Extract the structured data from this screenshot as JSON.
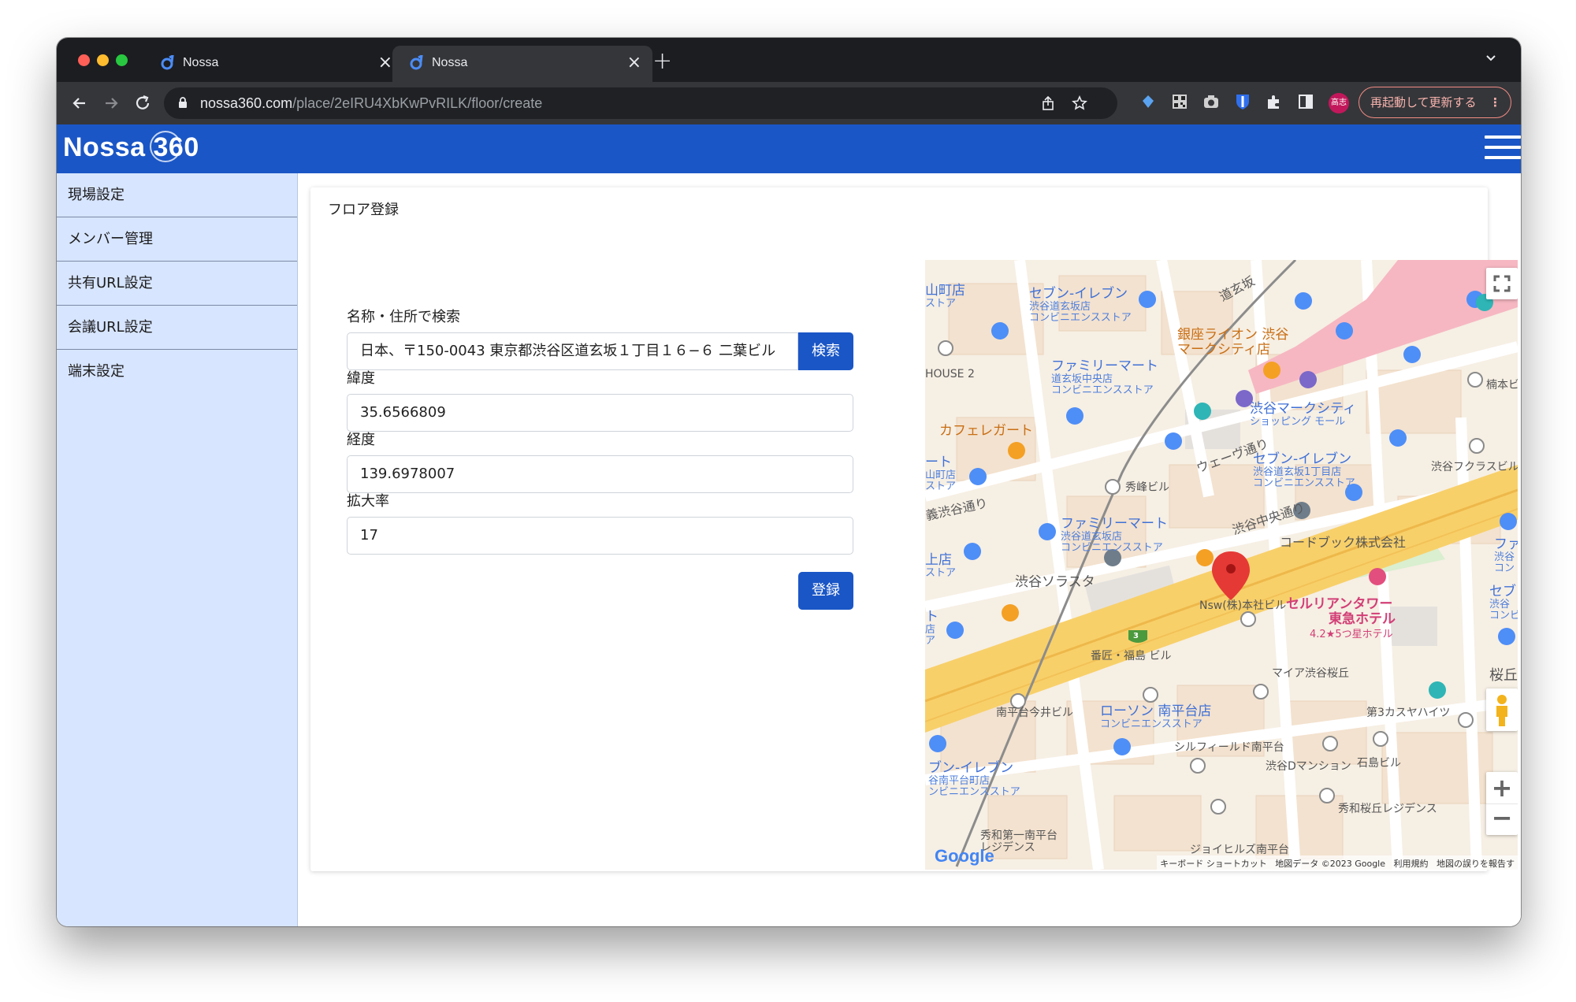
{
  "browser": {
    "tabs": [
      {
        "title": "Nossa",
        "active": false
      },
      {
        "title": "Nossa",
        "active": true
      }
    ],
    "close_glyph": "×",
    "new_tab_glyph": "+",
    "url_host": "nossa360.com",
    "url_path": "/place/2eIRU4XbKwPvRILK/floor/create",
    "profile_label": "高志",
    "update_button": "再起動して更新する",
    "menu_glyph": "⋮"
  },
  "app": {
    "logo_text": "Nossa 360",
    "sidebar": [
      {
        "label": "現場設定"
      },
      {
        "label": "メンバー管理"
      },
      {
        "label": "共有URL設定"
      },
      {
        "label": "会議URL設定"
      },
      {
        "label": "端末設定"
      }
    ],
    "card_title": "フロア登録",
    "form": {
      "search_label": "名称・住所で検索",
      "search_value": "日本、〒150-0043 東京都渋谷区道玄坂１丁目１６−６ 二葉ビル",
      "search_button": "検索",
      "lat_label": "緯度",
      "lat_value": "35.6566809",
      "lng_label": "経度",
      "lng_value": "139.6978007",
      "zoom_label": "拡大率",
      "zoom_value": "17",
      "submit_button": "登録"
    },
    "map": {
      "labels": [
        {
          "text": "セブン-イレブン",
          "sub": "渋谷道玄坂店",
          "sub2": "コンビニエンスストア"
        },
        {
          "text": "ファミリーマート",
          "sub": "道玄坂中央店",
          "sub2": "コンビニエンスストア"
        },
        {
          "text": "銀座ライオン 渋谷",
          "sub": "マークシティ店"
        },
        {
          "text": "渋谷マークシティ",
          "sub": "ショッピング モール"
        },
        {
          "text": "カフェレガート"
        },
        {
          "text": "セブン-イレブン",
          "sub": "渋谷道玄坂1丁目店",
          "sub2": "コンビニエンスストア"
        },
        {
          "text": "ファミリーマート",
          "sub": "渋谷道玄坂店",
          "sub2": "コンビニエンスストア"
        },
        {
          "text": "コードブック株式会社"
        },
        {
          "text": "渋谷ソラスタ"
        },
        {
          "text": "セルリアンタワー",
          "sub": "東急ホテル",
          "sub2": "4.2★5つ星ホテル"
        },
        {
          "text": "ローソン 南平台店",
          "sub": "コンビニエンスストア"
        },
        {
          "text": "ブン-イレブン",
          "sub": "谷南平台町店",
          "sub2": "ンビニエンスストア"
        },
        {
          "text": "道玄坂"
        },
        {
          "text": "ウェーヴ通り"
        },
        {
          "text": "渋谷中央通り"
        },
        {
          "text": "秀峰ビル"
        },
        {
          "text": "楠本ビル"
        },
        {
          "text": "渋谷フクラスビル"
        },
        {
          "text": "Nsw(株)本社ビル"
        },
        {
          "text": "番匠・福島 ビル"
        },
        {
          "text": "マイア渋谷桜丘"
        },
        {
          "text": "南平台今井ビル"
        },
        {
          "text": "第3カスヤハイツ"
        },
        {
          "text": "シルフィールド南平台"
        },
        {
          "text": "渋谷Dマンション"
        },
        {
          "text": "石島ビル"
        },
        {
          "text": "秀和桜丘レジデンス"
        },
        {
          "text": "秀和第一南平台",
          "sub": "レジデンス"
        },
        {
          "text": "ジョイヒルズ南平台"
        },
        {
          "text": "HOUSE 2"
        },
        {
          "text": "山町店",
          "sub": "ストア"
        },
        {
          "text": "ート",
          "sub": "山町店",
          "sub2": "ストア"
        },
        {
          "text": "義渋谷通り"
        },
        {
          "text": "上店",
          "sub": "ストア"
        },
        {
          "text": "ト",
          "sub": "店",
          "sub2": "ア"
        },
        {
          "text": "桜丘"
        },
        {
          "text": "ファ",
          "sub": "渋谷",
          "sub2": "コン"
        },
        {
          "text": "セブ",
          "sub": "渋谷",
          "sub2": "コンビ"
        }
      ],
      "route_number": "3",
      "attribution": [
        "キーボード ショートカット",
        "地図データ ©2023 Google",
        "利用規約",
        "地図の誤りを報告す"
      ],
      "google_logo": "Google",
      "zoom_in": "+",
      "zoom_out": "−",
      "fullscreen_icon": "fullscreen-icon",
      "pegman_icon": "pegman-icon",
      "marker_icon": "red-marker-icon"
    }
  }
}
